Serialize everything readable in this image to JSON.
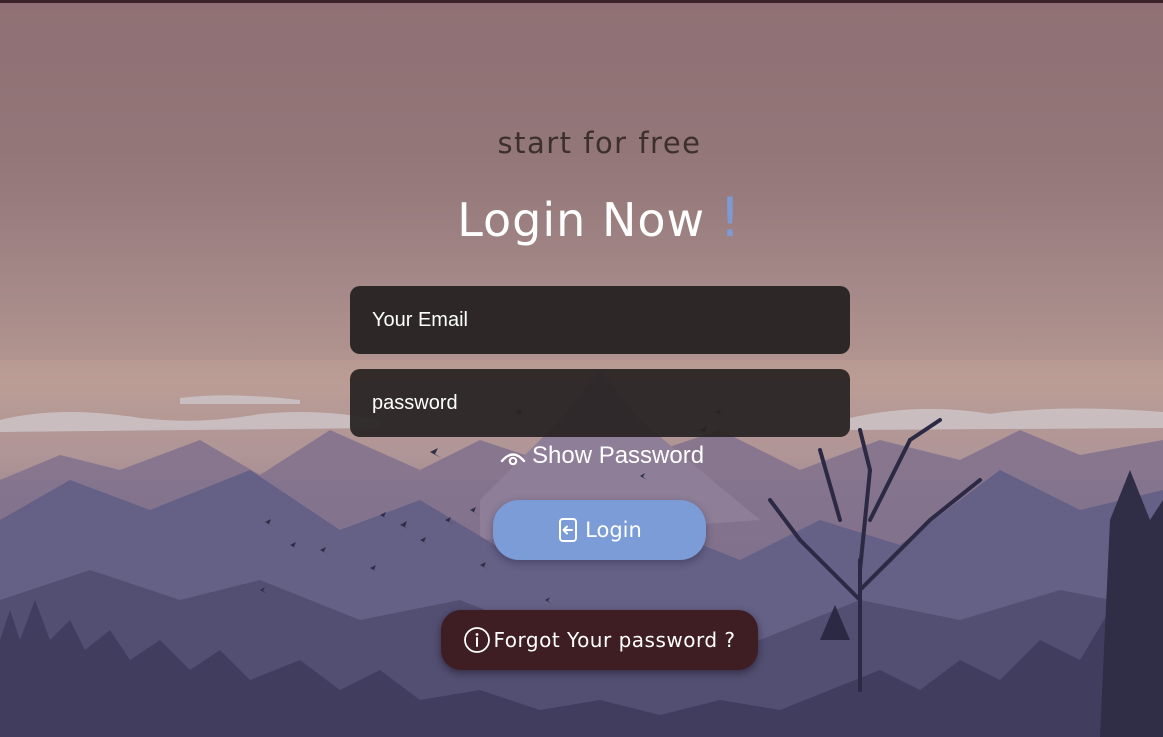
{
  "header": {
    "subtitle": "start for free",
    "title": "Login Now",
    "title_accent": "!"
  },
  "form": {
    "email_placeholder": "Your Email",
    "password_placeholder": "password",
    "show_password_label": "Show Password",
    "login_label": "Login",
    "forgot_label": "Forgot Your password ?"
  },
  "icons": {
    "show_password": "eye-icon",
    "login": "login-enter-icon",
    "forgot": "info-icon"
  },
  "colors": {
    "accent": "#7c9cd8",
    "input_background": "#2d2827",
    "forgot_button": "#3e1e22"
  }
}
